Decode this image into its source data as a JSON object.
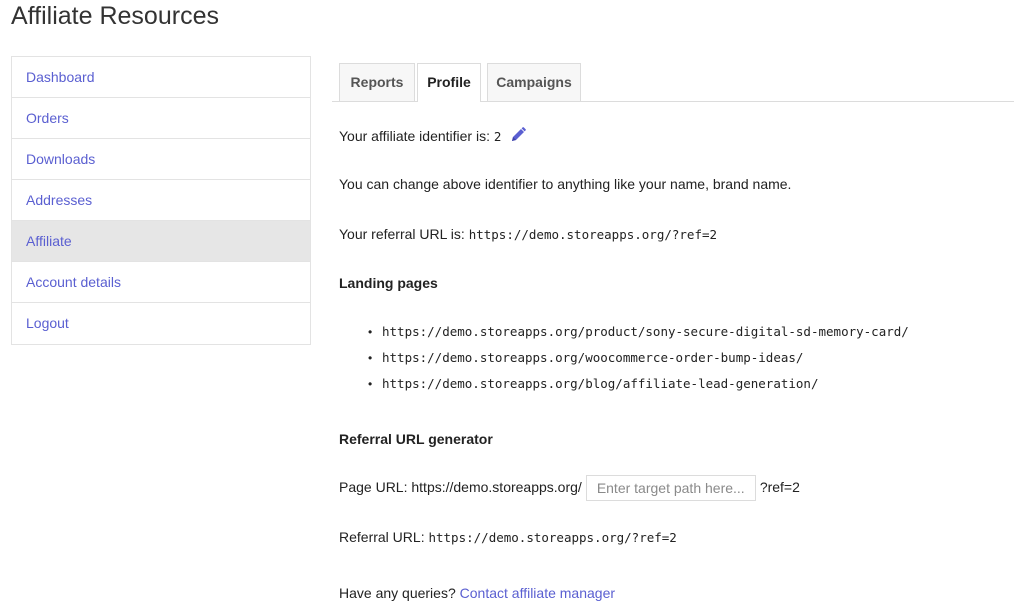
{
  "page_title": "Affiliate Resources",
  "sidebar": {
    "items": [
      {
        "label": "Dashboard"
      },
      {
        "label": "Orders"
      },
      {
        "label": "Downloads"
      },
      {
        "label": "Addresses"
      },
      {
        "label": "Affiliate",
        "active": true
      },
      {
        "label": "Account details"
      },
      {
        "label": "Logout"
      }
    ]
  },
  "tabs": [
    {
      "label": "Reports"
    },
    {
      "label": "Profile",
      "active": true
    },
    {
      "label": "Campaigns"
    }
  ],
  "profile": {
    "identifier_label": "Your affiliate identifier is:",
    "identifier_value": "2",
    "edit_icon": "pencil-icon",
    "identifier_hint": "You can change above identifier to anything like your name, brand name.",
    "referral_url_label": "Your referral URL is:",
    "referral_url": "https://demo.storeapps.org/?ref=2",
    "landing_pages_heading": "Landing pages",
    "landing_pages": [
      "https://demo.storeapps.org/product/sony-secure-digital-sd-memory-card/",
      "https://demo.storeapps.org/woocommerce-order-bump-ideas/",
      "https://demo.storeapps.org/blog/affiliate-lead-generation/"
    ],
    "generator_heading": "Referral URL generator",
    "page_url_label": "Page URL: https://demo.storeapps.org/",
    "target_path_placeholder": "Enter target path here...",
    "target_path_value": "",
    "ref_suffix": "?ref=2",
    "generated_label": "Referral URL:",
    "generated_url": "https://demo.storeapps.org/?ref=2",
    "queries_text": "Have any queries?",
    "contact_link": "Contact affiliate manager"
  },
  "colors": {
    "link": "#5a5fd1",
    "active_bg": "#e6e6e6"
  }
}
